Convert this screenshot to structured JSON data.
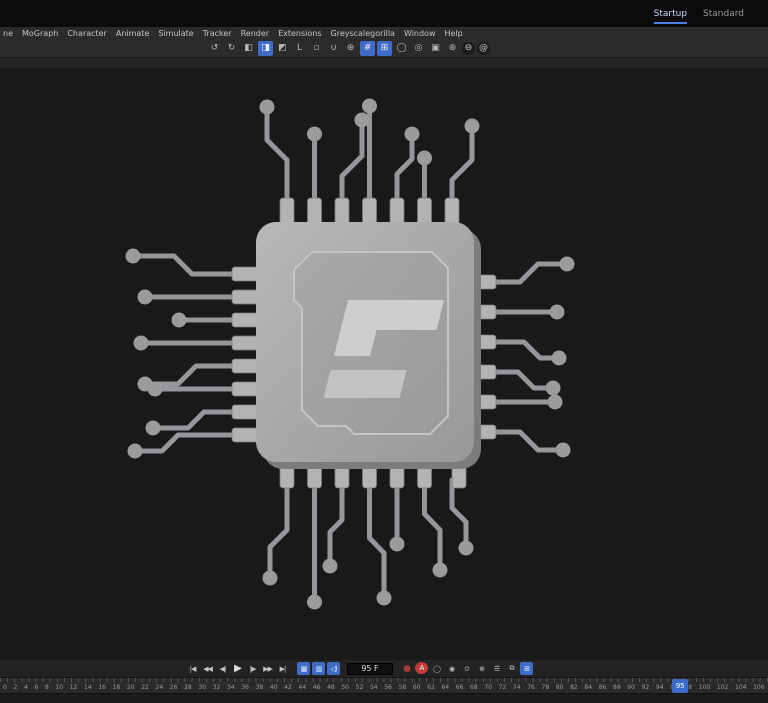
{
  "window": {
    "layout_tabs": [
      {
        "name": "layout-tab-startup",
        "label": "Startup",
        "state": "active"
      },
      {
        "name": "layout-tab-standard",
        "label": "Standard"
      }
    ]
  },
  "menu_bar": {
    "items": [
      {
        "name": "menu-item-clipped",
        "label": "ne"
      },
      {
        "name": "menu-item-mograph",
        "label": "MoGraph"
      },
      {
        "name": "menu-item-character",
        "label": "Character"
      },
      {
        "name": "menu-item-animate",
        "label": "Animate"
      },
      {
        "name": "menu-item-simulate",
        "label": "Simulate"
      },
      {
        "name": "menu-item-tracker",
        "label": "Tracker"
      },
      {
        "name": "menu-item-render",
        "label": "Render"
      },
      {
        "name": "menu-item-extensions",
        "label": "Extensions"
      },
      {
        "name": "menu-item-greyscalegorilla",
        "label": "Greyscalegorilla"
      },
      {
        "name": "menu-item-window",
        "label": "Window"
      },
      {
        "name": "menu-item-help",
        "label": "Help"
      }
    ]
  },
  "toolbar": {
    "icons": [
      {
        "name": "undo-icon",
        "glyph": "↺"
      },
      {
        "name": "redo-icon",
        "glyph": "↻"
      },
      {
        "name": "select-tool-icon",
        "glyph": "◧"
      },
      {
        "name": "move-tool-icon",
        "glyph": "◨",
        "state": "active"
      },
      {
        "name": "scale-tool-icon",
        "glyph": "◩"
      },
      {
        "name": "axis-lock-icon",
        "glyph": "L"
      },
      {
        "name": "coord-system-icon",
        "glyph": "▫"
      },
      {
        "name": "snap-magnet-icon",
        "glyph": "∪"
      },
      {
        "name": "dynamic-guides-icon",
        "glyph": "⊕"
      },
      {
        "name": "quantize-icon",
        "glyph": "#",
        "state": "active"
      },
      {
        "name": "grid-snap-icon",
        "glyph": "⊞",
        "state": "active"
      },
      {
        "name": "workplane-icon",
        "glyph": "◯"
      },
      {
        "name": "target-mode-icon",
        "glyph": "◎"
      },
      {
        "name": "camera-icon",
        "glyph": "▣"
      },
      {
        "name": "settings-icon",
        "glyph": "⊛"
      },
      {
        "name": "minus-badge-icon",
        "glyph": "⊖",
        "state": "dark"
      },
      {
        "name": "gorilla-badge-icon",
        "glyph": "@",
        "state": "dark"
      }
    ]
  },
  "timeline": {
    "transport": [
      {
        "name": "goto-start-button",
        "glyph": "|◀"
      },
      {
        "name": "prev-key-button",
        "glyph": "◀◀"
      },
      {
        "name": "prev-frame-button",
        "glyph": "◀|"
      },
      {
        "name": "play-button",
        "glyph": "▶",
        "state": "big"
      },
      {
        "name": "next-frame-button",
        "glyph": "|▶"
      },
      {
        "name": "next-key-button",
        "glyph": "▶▶"
      },
      {
        "name": "goto-end-button",
        "glyph": "▶|"
      }
    ],
    "toggles": [
      {
        "name": "play-mode-toggle",
        "glyph": "▦",
        "state": "active"
      },
      {
        "name": "key-mode-toggle",
        "glyph": "▥",
        "state": "active"
      },
      {
        "name": "sound-toggle-icon",
        "glyph": "◁)",
        "state": "active"
      }
    ],
    "frame_field": {
      "value": "95 F"
    },
    "record_icons": [
      {
        "name": "record-keyframe-button",
        "glyph": "●",
        "state": "reddot"
      },
      {
        "name": "autokey-button",
        "glyph": "A",
        "state": "red"
      },
      {
        "name": "keyframe-selection-button",
        "glyph": "◯"
      },
      {
        "name": "record-position-button",
        "glyph": "◉"
      },
      {
        "name": "record-scale-button",
        "glyph": "⊙"
      },
      {
        "name": "record-rotation-button",
        "glyph": "⊕"
      },
      {
        "name": "record-parameter-button",
        "glyph": "☰"
      },
      {
        "name": "record-pla-button",
        "glyph": "⧉"
      },
      {
        "name": "solo-button",
        "glyph": "⊞",
        "state": "active"
      }
    ],
    "playhead": {
      "frame": 95,
      "label": "95"
    }
  },
  "ruler": {
    "numbers": [
      0,
      2,
      4,
      6,
      8,
      10,
      12,
      14,
      16,
      18,
      20,
      22,
      24,
      26,
      28,
      30,
      32,
      34,
      36,
      38,
      40,
      42,
      44,
      46,
      48,
      50,
      52,
      54,
      56,
      58,
      60,
      62,
      64,
      66,
      68,
      70,
      72,
      74,
      76,
      78,
      80,
      82,
      84,
      86,
      88,
      90,
      92,
      94,
      96,
      98,
      100,
      102,
      104,
      106
    ]
  },
  "colors": {
    "accent_blue": "#3f6cc7",
    "autokey_red": "#c03b3b",
    "chip_grey": "#a5a6a8",
    "viewport_bg": "#191919"
  }
}
